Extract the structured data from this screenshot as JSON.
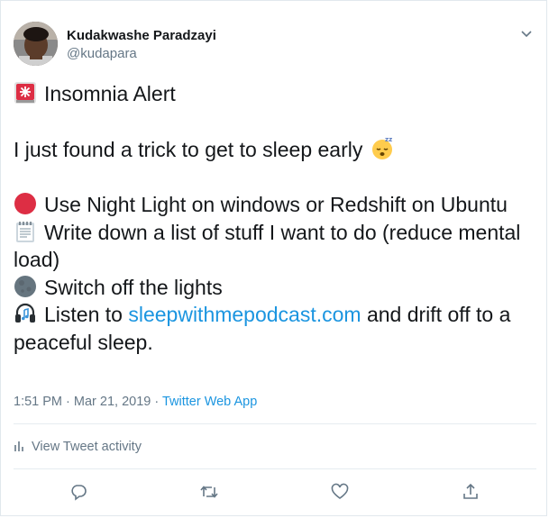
{
  "author": {
    "name": "Kudakwashe Paradzayi",
    "handle": "@kudapara"
  },
  "tweet": {
    "line1": "Insomnia Alert",
    "line2": "I just found a trick to get to sleep early",
    "tip1": "Use Night Light on windows or Redshift on Ubuntu",
    "tip2": "Write down a list of stuff I want to do (reduce mental load)",
    "tip3": "Switch off the lights",
    "tip4_before": "Listen to",
    "tip4_link": "sleepwithmepodcast.com",
    "tip4_after": "and drift off to a peaceful sleep."
  },
  "meta": {
    "time": "1:51 PM · Mar 21, 2019 ·",
    "source": "Twitter Web App"
  },
  "activity_label": "View Tweet activity",
  "icons": {
    "line1": "rotating-light-icon",
    "line2": "sleeping-face-icon",
    "tip1": "red-circle-icon",
    "tip2": "notepad-icon",
    "tip3": "new-moon-icon",
    "tip4": "headphones-icon",
    "actions": [
      "reply-icon",
      "retweet-icon",
      "like-icon",
      "share-icon"
    ]
  },
  "colors": {
    "link": "#1b95e0",
    "muted": "#657786",
    "text": "#14171a"
  }
}
